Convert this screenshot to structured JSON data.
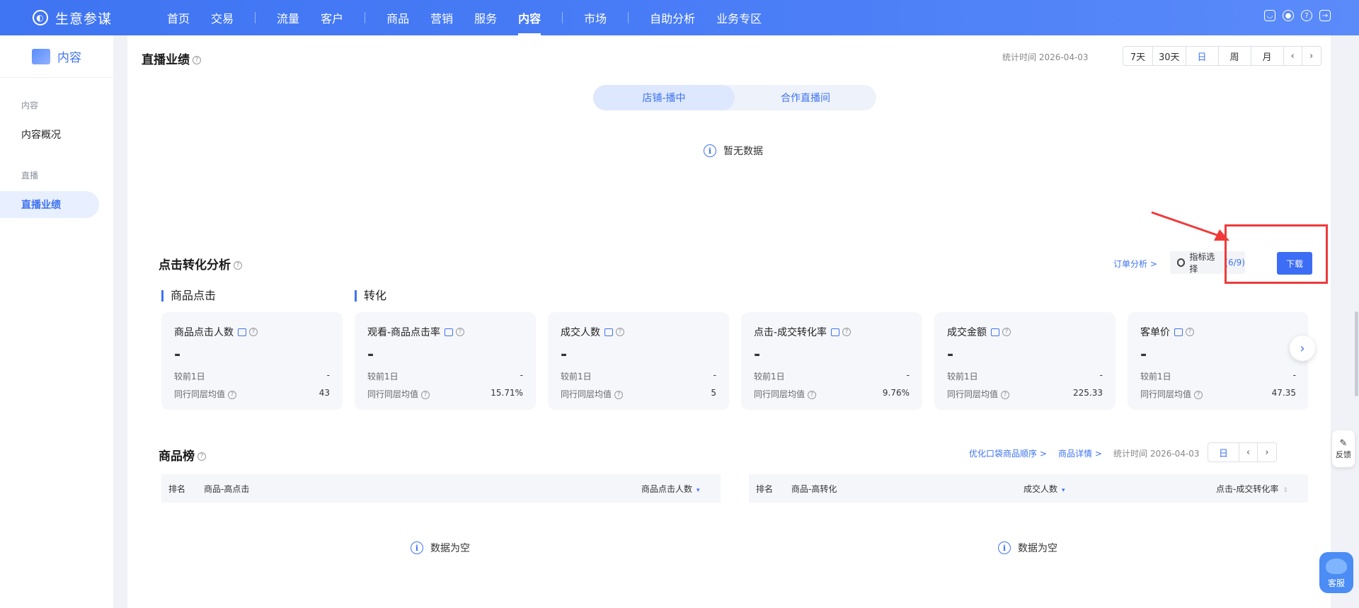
{
  "app": {
    "brand": "生意参谋"
  },
  "nav": {
    "items": [
      "首页",
      "交易",
      "流量",
      "客户",
      "商品",
      "营销",
      "服务",
      "内容",
      "市场",
      "自助分析",
      "业务专区"
    ],
    "active": "内容"
  },
  "sidebar": {
    "title": "内容",
    "groups": [
      {
        "label": "内容",
        "items": [
          "内容概况"
        ]
      },
      {
        "label": "直播",
        "items": [
          "直播业绩"
        ]
      }
    ],
    "active": "直播业绩"
  },
  "live": {
    "title": "直播业绩",
    "stat_time": "统计时间 2026-04-03",
    "periods": [
      "7天",
      "30天",
      "日",
      "周",
      "月"
    ],
    "active_period": "日",
    "tabs": [
      "店铺-播中",
      "合作直播间"
    ],
    "active_tab": "店铺-播中",
    "empty": "暂无数据"
  },
  "click": {
    "title": "点击转化分析",
    "order_link": "订单分析 >",
    "indicator_label": "指标选择",
    "indicator_count": "(6/9)",
    "download": "下载",
    "group1": "商品点击",
    "group2": "转化",
    "cards": [
      {
        "title": "商品点击人数",
        "value": "-",
        "prev_label": "较前1日",
        "prev": "-",
        "peer_label": "同行同层均值",
        "peer": "43"
      },
      {
        "title": "观看-商品点击率",
        "value": "-",
        "prev_label": "较前1日",
        "prev": "-",
        "peer_label": "同行同层均值",
        "peer": "15.71%"
      },
      {
        "title": "成交人数",
        "value": "-",
        "prev_label": "较前1日",
        "prev": "-",
        "peer_label": "同行同层均值",
        "peer": "5"
      },
      {
        "title": "点击-成交转化率",
        "value": "-",
        "prev_label": "较前1日",
        "prev": "-",
        "peer_label": "同行同层均值",
        "peer": "9.76%"
      },
      {
        "title": "成交金额",
        "value": "-",
        "prev_label": "较前1日",
        "prev": "-",
        "peer_label": "同行同层均值",
        "peer": "225.33"
      },
      {
        "title": "客单价",
        "value": "-",
        "prev_label": "较前1日",
        "prev": "-",
        "peer_label": "同行同层均值",
        "peer": "47.35"
      }
    ]
  },
  "rank": {
    "title": "商品榜",
    "link1": "优化口袋商品顺序 >",
    "link2": "商品详情 >",
    "stat_time": "统计时间 2026-04-03",
    "period": "日",
    "left": {
      "col_rank": "排名",
      "col_item": "商品-高点击",
      "col_metric": "商品点击人数",
      "empty": "数据为空"
    },
    "right": {
      "col_rank": "排名",
      "col_item": "商品-高转化",
      "col_metric1": "成交人数",
      "col_metric2": "点击-成交转化率",
      "empty": "数据为空"
    }
  },
  "float": {
    "feedback": "反馈",
    "service": "客服"
  },
  "colors": {
    "primary": "#3f73f0",
    "highlight": "#f03a3a"
  }
}
